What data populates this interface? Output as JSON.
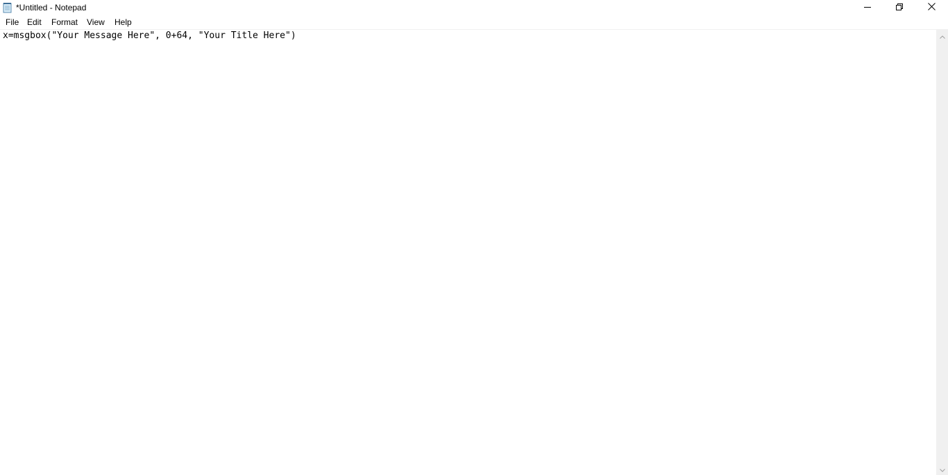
{
  "window": {
    "title": "*Untitled - Notepad"
  },
  "icons": {
    "app": "notepad-icon",
    "minimize": "minimize-icon",
    "maximize": "restore-icon",
    "close": "close-icon",
    "scroll_up": "chevron-up-icon",
    "scroll_down": "chevron-down-icon"
  },
  "menu": {
    "file": "File",
    "edit": "Edit",
    "format": "Format",
    "view": "View",
    "help": "Help"
  },
  "editor": {
    "content": "x=msgbox(\"Your Message Here\", 0+64, \"Your Title Here\")"
  },
  "colors": {
    "background": "#ffffff",
    "scrollbar": "#f0f0f0",
    "text": "#000000"
  }
}
